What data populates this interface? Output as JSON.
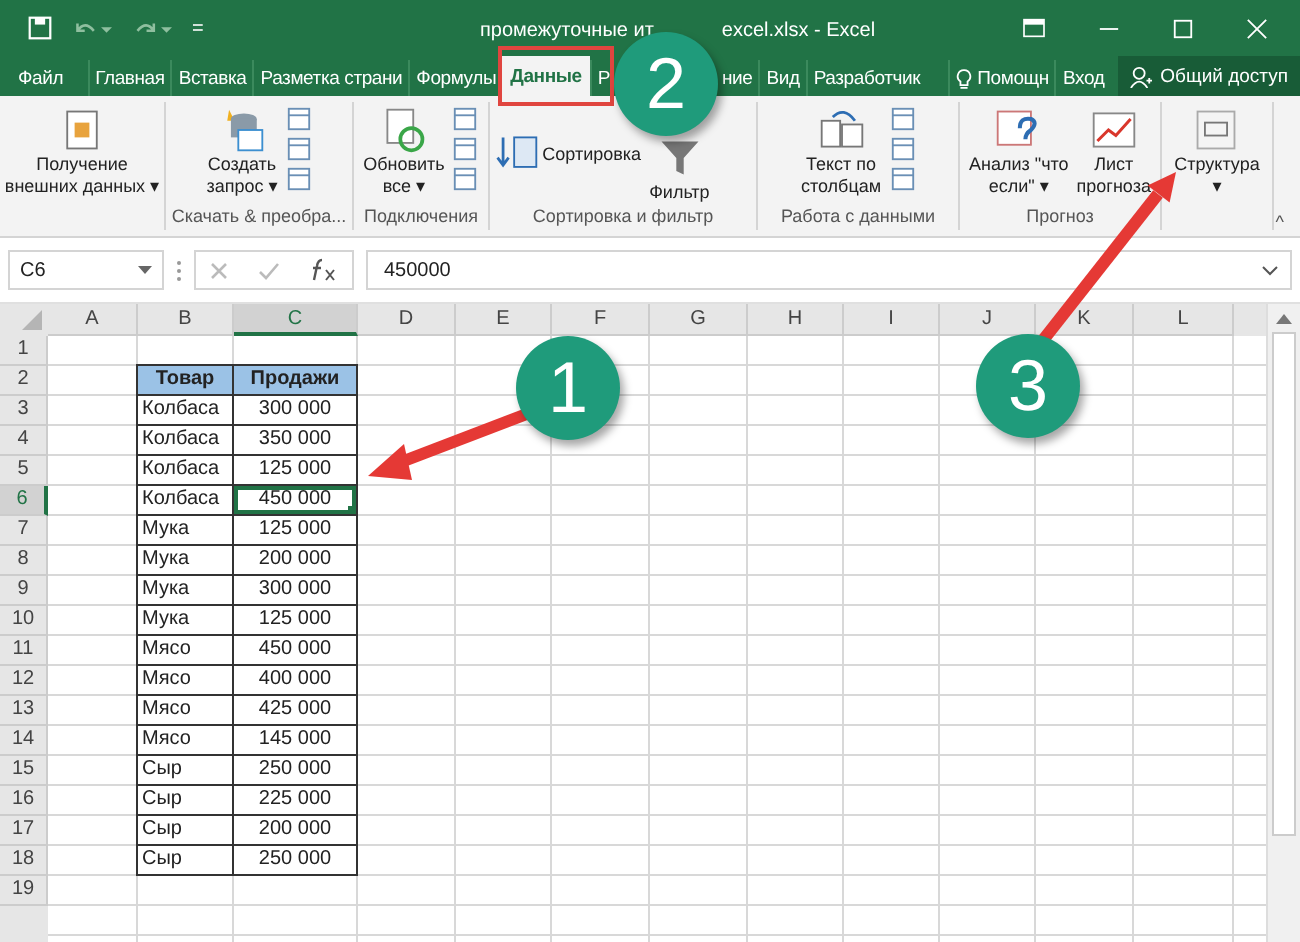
{
  "window": {
    "title_parts": [
      "промежуточные ит",
      "excel.xlsx - Excel"
    ],
    "quick_access": [
      "="
    ]
  },
  "tabs": [
    {
      "label_parts": [
        "Файл"
      ],
      "selected": false
    },
    {
      "label_parts": [
        "Главная"
      ],
      "selected": false
    },
    {
      "label_parts": [
        "Вставка"
      ],
      "selected": false
    },
    {
      "label_parts": [
        "Разметка страни"
      ],
      "selected": false
    },
    {
      "label_parts": [
        "Формулы"
      ],
      "selected": false
    },
    {
      "label_parts": [
        "Данные"
      ],
      "selected": true
    },
    {
      "label_parts": [
        "Р",
        "ние"
      ],
      "selected": false
    },
    {
      "label_parts": [
        "Вид"
      ],
      "selected": false
    },
    {
      "label_parts": [
        "Разработчик"
      ],
      "selected": false
    }
  ],
  "tell_me": "Помощн",
  "sign_in": "Вход",
  "share": "Общий доступ",
  "ribbon": {
    "groups": [
      {
        "buttons": [
          {
            "lines": [
              "Получение",
              "внешних данных ▾"
            ]
          }
        ]
      },
      {
        "label": "Скачать & преобра...",
        "buttons": [
          {
            "lines": [
              "Создать",
              "запрос ▾"
            ]
          }
        ]
      },
      {
        "label": "Подключения",
        "buttons": [
          {
            "lines": [
              "Обновить",
              "все ▾"
            ]
          }
        ]
      },
      {
        "label": "Сортировка и фильтр",
        "buttons": [
          {
            "lines": [
              "Сортировка"
            ]
          },
          {
            "lines": [
              "Фильтр"
            ]
          }
        ]
      },
      {
        "label": "Работа с данными",
        "buttons": [
          {
            "lines": [
              "Текст по",
              "столбцам"
            ]
          }
        ]
      },
      {
        "label": "Прогноз",
        "buttons": [
          {
            "lines": [
              "Анализ \"что",
              "если\" ▾"
            ]
          },
          {
            "lines": [
              "Лист",
              "прогноза"
            ]
          }
        ]
      },
      {
        "buttons": [
          {
            "lines": [
              "Структура",
              "▾"
            ]
          }
        ]
      }
    ],
    "collapse": "^"
  },
  "formula_bar": {
    "name_box": "C6",
    "value": "450000"
  },
  "sheet": {
    "columns": [
      {
        "label": "A",
        "selected": false
      },
      {
        "label": "B",
        "selected": false
      },
      {
        "label": "C",
        "selected": true
      },
      {
        "label": "D",
        "selected": false
      },
      {
        "label": "E",
        "selected": false
      },
      {
        "label": "F",
        "selected": false
      },
      {
        "label": "G",
        "selected": false
      },
      {
        "label": "H",
        "selected": false
      },
      {
        "label": "I",
        "selected": false
      },
      {
        "label": "J",
        "selected": false
      },
      {
        "label": "K",
        "selected": false
      },
      {
        "label": "L",
        "selected": false
      }
    ],
    "rows": [
      {
        "header": "1",
        "selected": false,
        "kind": "empty"
      },
      {
        "header": "2",
        "selected": false,
        "kind": "table-header",
        "b": "Товар",
        "c": "Продажи"
      },
      {
        "header": "3",
        "selected": false,
        "kind": "data",
        "b": "Колбаса",
        "c": "300 000"
      },
      {
        "header": "4",
        "selected": false,
        "kind": "data",
        "b": "Колбаса",
        "c": "350 000"
      },
      {
        "header": "5",
        "selected": false,
        "kind": "data",
        "b": "Колбаса",
        "c": "125 000"
      },
      {
        "header": "6",
        "selected": true,
        "kind": "data",
        "b": "Колбаса",
        "c": "450 000"
      },
      {
        "header": "7",
        "selected": false,
        "kind": "data",
        "b": "Мука",
        "c": "125 000"
      },
      {
        "header": "8",
        "selected": false,
        "kind": "data",
        "b": "Мука",
        "c": "200 000"
      },
      {
        "header": "9",
        "selected": false,
        "kind": "data",
        "b": "Мука",
        "c": "300 000"
      },
      {
        "header": "10",
        "selected": false,
        "kind": "data",
        "b": "Мука",
        "c": "125 000"
      },
      {
        "header": "11",
        "selected": false,
        "kind": "data",
        "b": "Мясо",
        "c": "450 000"
      },
      {
        "header": "12",
        "selected": false,
        "kind": "data",
        "b": "Мясо",
        "c": "400 000"
      },
      {
        "header": "13",
        "selected": false,
        "kind": "data",
        "b": "Мясо",
        "c": "425 000"
      },
      {
        "header": "14",
        "selected": false,
        "kind": "data",
        "b": "Мясо",
        "c": "145 000"
      },
      {
        "header": "15",
        "selected": false,
        "kind": "data",
        "b": "Сыр",
        "c": "250 000"
      },
      {
        "header": "16",
        "selected": false,
        "kind": "data",
        "b": "Сыр",
        "c": "225 000"
      },
      {
        "header": "17",
        "selected": false,
        "kind": "data",
        "b": "Сыр",
        "c": "200 000"
      },
      {
        "header": "18",
        "selected": false,
        "kind": "data",
        "b": "Сыр",
        "c": "250 000"
      },
      {
        "header": "19",
        "selected": false,
        "kind": "empty"
      }
    ]
  },
  "callouts": [
    {
      "number": "1"
    },
    {
      "number": "2"
    },
    {
      "number": "3"
    }
  ]
}
